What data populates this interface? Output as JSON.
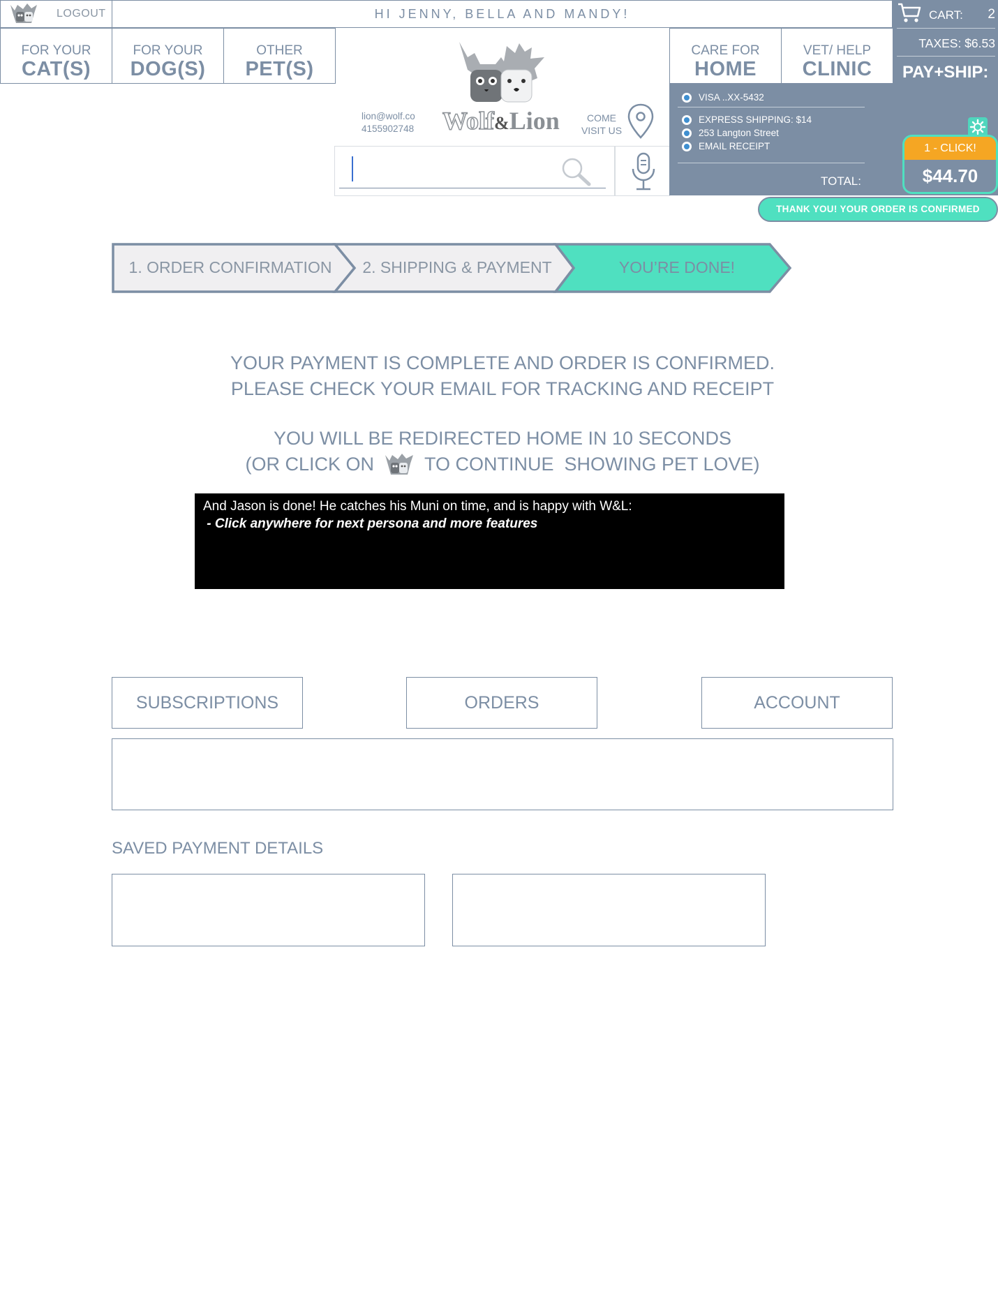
{
  "header": {
    "logout_label": "LOGOUT",
    "greeting": "HI JENNY, BELLA AND MANDY!"
  },
  "nav": {
    "cats": {
      "small": "FOR YOUR",
      "big": "CAT(S)"
    },
    "dogs": {
      "small": "FOR YOUR",
      "big": "DOG(S)"
    },
    "other": {
      "small": "OTHER",
      "big": "PET(S)"
    },
    "home": {
      "small": "CARE FOR",
      "big": "HOME"
    },
    "clinic": {
      "small": "VET/ HELP",
      "big": "CLINIC"
    }
  },
  "brand": {
    "logo_text_wolf": "Wolf",
    "logo_text_amp": "&",
    "logo_text_lion": "Lion",
    "email": "lion@wolf.co",
    "phone": "4155902748",
    "visit_line1": "COME",
    "visit_line2": "VISIT US"
  },
  "search": {
    "placeholder": ""
  },
  "cart": {
    "label": "CART:",
    "count": "2",
    "taxes": "TAXES: $6.53",
    "pay_ship": "PAY+SHIP:",
    "card": "VISA ..XX-5432",
    "shipping": "EXPRESS SHIPPING: $14",
    "address": "253 Langton Street",
    "receipt": "EMAIL RECEIPT",
    "total_label": "TOTAL:",
    "total_value": "$44.70",
    "one_click": "1 - CLICK!",
    "confirmation": "THANK YOU! YOUR ORDER IS CONFIRMED"
  },
  "steps": [
    {
      "label": "1. ORDER CONFIRMATION"
    },
    {
      "label": "2. SHIPPING & PAYMENT"
    },
    {
      "label": "YOU’RE DONE!"
    }
  ],
  "message": {
    "line1": "YOUR PAYMENT IS COMPLETE AND ORDER IS CONFIRMED.",
    "line2": "PLEASE CHECK YOUR EMAIL FOR TRACKING AND RECEIPT",
    "line3": "YOU WILL BE REDIRECTED HOME IN 10 SECONDS",
    "line4_before": "(OR CLICK ON",
    "line4_after": "TO CONTINUE  SHOWING PET LOVE)"
  },
  "overlay": {
    "line1": "And Jason is done! He catches his Muni on time, and is happy with W&L:",
    "line2": " - Click anywhere for next persona and more features"
  },
  "account": {
    "subscriptions": "SUBSCRIPTIONS",
    "orders": "ORDERS",
    "account": "ACCOUNT",
    "saved_payment_title": "SAVED PAYMENT DETAILS"
  },
  "colors": {
    "slate": "#7c8ea4",
    "teal": "#4fe0c0",
    "orange": "#f5a623",
    "step_gray": "#f0eff1"
  }
}
